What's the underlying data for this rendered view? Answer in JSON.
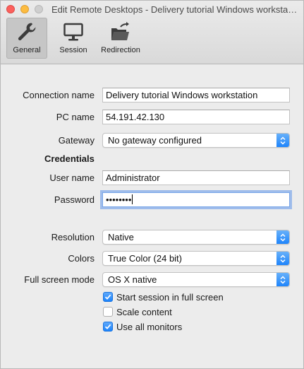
{
  "window": {
    "title": "Edit Remote Desktops - Delivery tutorial Windows workstation"
  },
  "toolbar": {
    "items": [
      {
        "label": "General",
        "icon": "wrench-icon",
        "active": true
      },
      {
        "label": "Session",
        "icon": "monitor-icon",
        "active": false
      },
      {
        "label": "Redirection",
        "icon": "folder-redirect-icon",
        "active": false
      }
    ]
  },
  "form": {
    "connection_name": {
      "label": "Connection name",
      "value": "Delivery tutorial Windows workstation"
    },
    "pc_name": {
      "label": "PC name",
      "value": "54.191.42.130"
    },
    "gateway": {
      "label": "Gateway",
      "value": "No gateway configured"
    },
    "credentials_title": "Credentials",
    "user_name": {
      "label": "User name",
      "value": "Administrator"
    },
    "password": {
      "label": "Password",
      "value": "••••••••"
    },
    "resolution": {
      "label": "Resolution",
      "value": "Native"
    },
    "colors": {
      "label": "Colors",
      "value": "True Color (24 bit)"
    },
    "full_screen_mode": {
      "label": "Full screen mode",
      "value": "OS X native"
    },
    "checkboxes": [
      {
        "label": "Start session in full screen",
        "checked": true
      },
      {
        "label": "Scale content",
        "checked": false
      },
      {
        "label": "Use all monitors",
        "checked": true
      }
    ]
  },
  "colors": {
    "accent": "#1a82fb",
    "focus_ring": "#7aa7e9"
  }
}
